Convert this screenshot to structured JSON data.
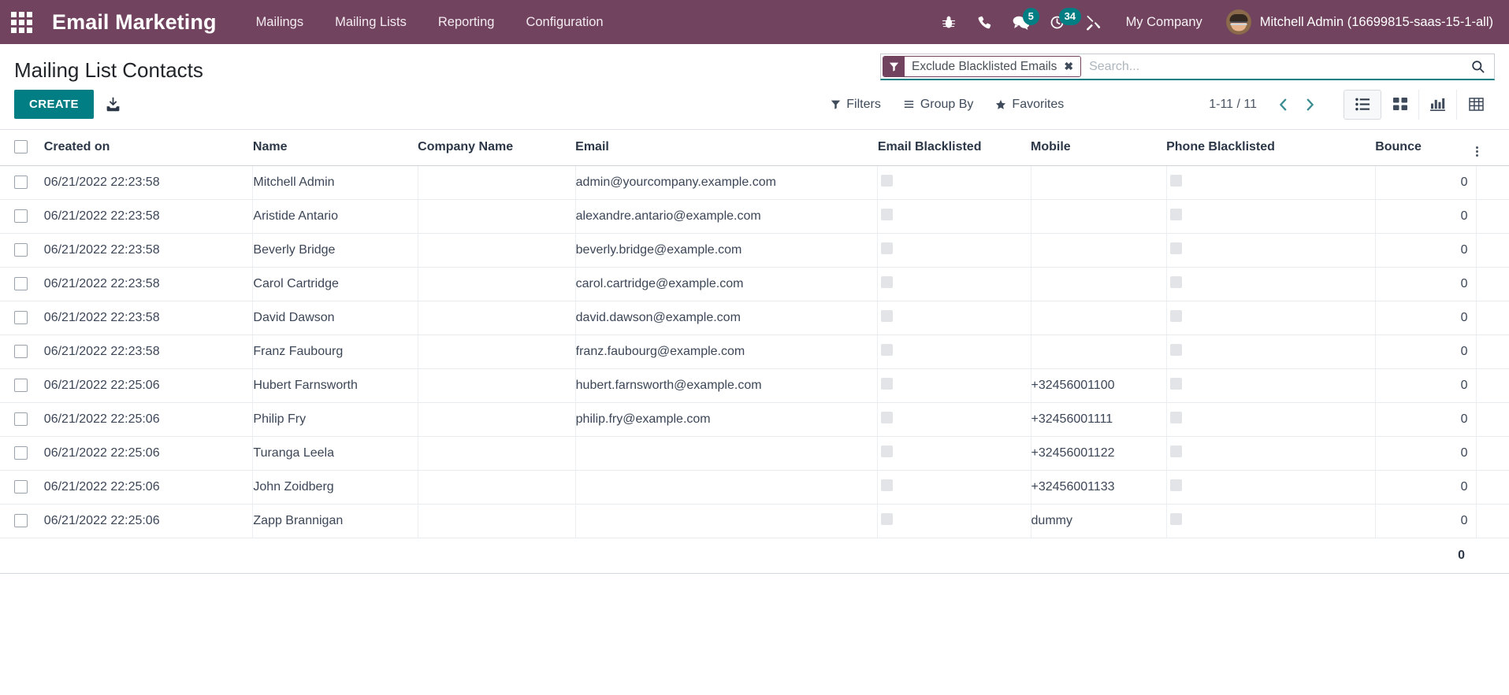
{
  "navbar": {
    "apps_icon": "apps-grid-icon",
    "brand": "Email Marketing",
    "menu": [
      {
        "label": "Mailings"
      },
      {
        "label": "Mailing Lists"
      },
      {
        "label": "Reporting"
      },
      {
        "label": "Configuration"
      }
    ],
    "icons": [
      {
        "name": "bug-icon",
        "badge": ""
      },
      {
        "name": "phone-icon",
        "badge": ""
      },
      {
        "name": "messages-icon",
        "badge": "5"
      },
      {
        "name": "activities-clock-icon",
        "badge": "34"
      },
      {
        "name": "developer-tools-icon",
        "badge": ""
      }
    ],
    "company": "My Company",
    "user": "Mitchell Admin (16699815-saas-15-1-all)"
  },
  "control_panel": {
    "title": "Mailing List Contacts",
    "create_label": "CREATE",
    "import_icon": "import-download-icon",
    "search": {
      "facet": {
        "icon": "filter-funnel-icon",
        "label": "Exclude Blacklisted Emails",
        "remove": "✖"
      },
      "placeholder": "Search...",
      "value": "",
      "submit_icon": "search-icon"
    },
    "filters_label": "Filters",
    "group_by_label": "Group By",
    "favorites_label": "Favorites",
    "pager": {
      "value": "1-11 / 11",
      "previous_icon": "chevron-left-icon",
      "next_icon": "chevron-right-icon"
    },
    "views": [
      {
        "name": "list-view-button",
        "active": true
      },
      {
        "name": "kanban-view-button",
        "active": false
      },
      {
        "name": "graph-view-button",
        "active": false
      },
      {
        "name": "pivot-view-button",
        "active": false
      }
    ]
  },
  "table": {
    "columns": [
      "Created on",
      "Name",
      "Company Name",
      "Email",
      "Email Blacklisted",
      "Mobile",
      "Phone Blacklisted",
      "Bounce"
    ],
    "rows": [
      {
        "created_on": "06/21/2022 22:23:58",
        "name": "Mitchell Admin",
        "company": "",
        "email": "admin@yourcompany.example.com",
        "mobile": "",
        "bounce": "0"
      },
      {
        "created_on": "06/21/2022 22:23:58",
        "name": "Aristide Antario",
        "company": "",
        "email": "alexandre.antario@example.com",
        "mobile": "",
        "bounce": "0"
      },
      {
        "created_on": "06/21/2022 22:23:58",
        "name": "Beverly Bridge",
        "company": "",
        "email": "beverly.bridge@example.com",
        "mobile": "",
        "bounce": "0"
      },
      {
        "created_on": "06/21/2022 22:23:58",
        "name": "Carol Cartridge",
        "company": "",
        "email": "carol.cartridge@example.com",
        "mobile": "",
        "bounce": "0"
      },
      {
        "created_on": "06/21/2022 22:23:58",
        "name": "David Dawson",
        "company": "",
        "email": "david.dawson@example.com",
        "mobile": "",
        "bounce": "0"
      },
      {
        "created_on": "06/21/2022 22:23:58",
        "name": "Franz Faubourg",
        "company": "",
        "email": "franz.faubourg@example.com",
        "mobile": "",
        "bounce": "0"
      },
      {
        "created_on": "06/21/2022 22:25:06",
        "name": "Hubert Farnsworth",
        "company": "",
        "email": "hubert.farnsworth@example.com",
        "mobile": "+32456001100",
        "bounce": "0"
      },
      {
        "created_on": "06/21/2022 22:25:06",
        "name": "Philip Fry",
        "company": "",
        "email": "philip.fry@example.com",
        "mobile": "+32456001111",
        "bounce": "0"
      },
      {
        "created_on": "06/21/2022 22:25:06",
        "name": "Turanga Leela",
        "company": "",
        "email": "",
        "mobile": "+32456001122",
        "bounce": "0"
      },
      {
        "created_on": "06/21/2022 22:25:06",
        "name": "John Zoidberg",
        "company": "",
        "email": "",
        "mobile": "+32456001133",
        "bounce": "0"
      },
      {
        "created_on": "06/21/2022 22:25:06",
        "name": "Zapp Brannigan",
        "company": "",
        "email": "",
        "mobile": "dummy",
        "bounce": "0"
      }
    ],
    "footer": {
      "bounce_total": "0"
    }
  },
  "colors": {
    "navbar": "#71435f",
    "accent": "#017e84",
    "badge": "#017e84"
  }
}
